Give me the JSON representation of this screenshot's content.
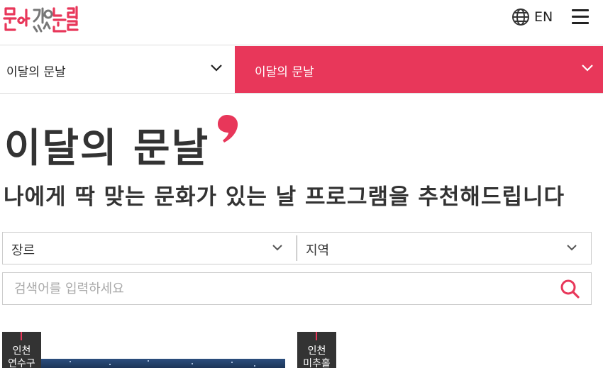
{
  "brand": {
    "accent": "#e8375a",
    "logo_text": "문화가있는날"
  },
  "header": {
    "language_label": "EN",
    "icons": [
      "globe-icon",
      "hamburger-menu-icon"
    ]
  },
  "nav": {
    "left_label": "이달의 문날",
    "right_label": "이달의 문날"
  },
  "page": {
    "title": "이달의 문날",
    "subtitle": "나에게 딱 맞는 문화가 있는 날 프로그램을 추천해드립니다"
  },
  "filters": {
    "genre_label": "장르",
    "region_label": "지역"
  },
  "search": {
    "placeholder": "검색어를 입력하세요",
    "value": ""
  },
  "cards": [
    {
      "region": "인천",
      "district": "연수구"
    },
    {
      "region": "인천",
      "district": "미추홀"
    }
  ]
}
